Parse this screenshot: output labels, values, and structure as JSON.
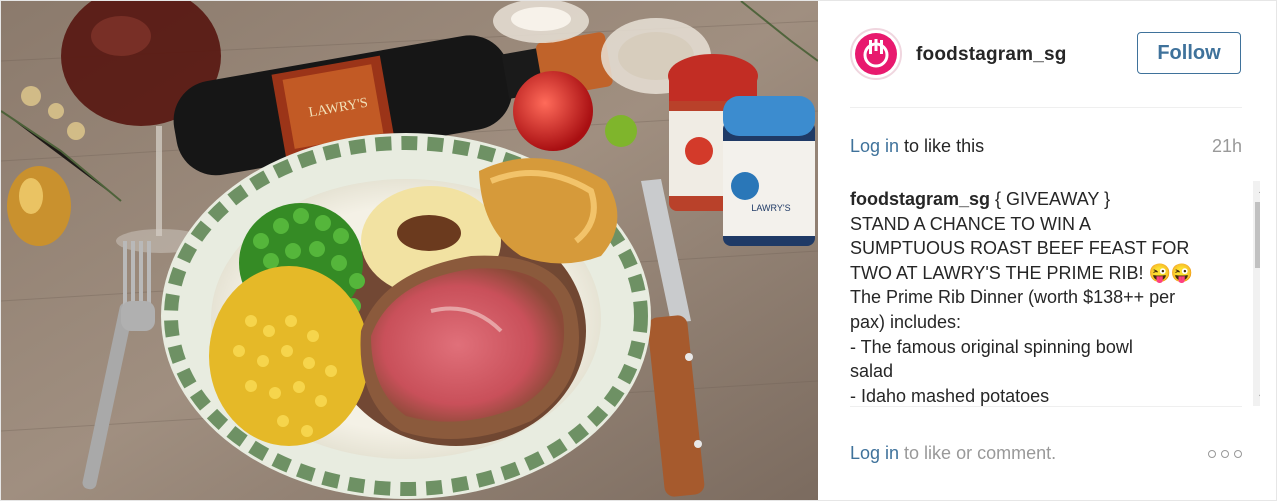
{
  "post": {
    "username": "foodstagram_sg",
    "follow_label": "Follow",
    "like_link": "Log in",
    "like_suffix": " to like this",
    "time_ago": "21h",
    "caption_author": "foodstagram_sg",
    "caption_lines": [
      " { GIVEAWAY }",
      "STAND A CHANCE TO WIN A",
      "SUMPTUOUS ROAST BEEF FEAST FOR",
      "TWO AT LAWRY'S THE PRIME RIB! 😜😜",
      "The Prime Rib Dinner (worth $138++ per",
      "pax) includes:",
      "- The famous original spinning bowl",
      "salad",
      "- Idaho mashed potatoes"
    ],
    "footer_link": "Log in",
    "footer_suffix": " to like or comment."
  },
  "photo": {
    "bottle_label": "LAWRY'S",
    "shaker_label": "LAWRY'S"
  },
  "colors": {
    "link": "#3f729b",
    "avatar_brand": "#e8196e",
    "muted": "#999999"
  },
  "icons": {
    "avatar": "utensils-logo",
    "more": "more-options-ellipsis"
  }
}
